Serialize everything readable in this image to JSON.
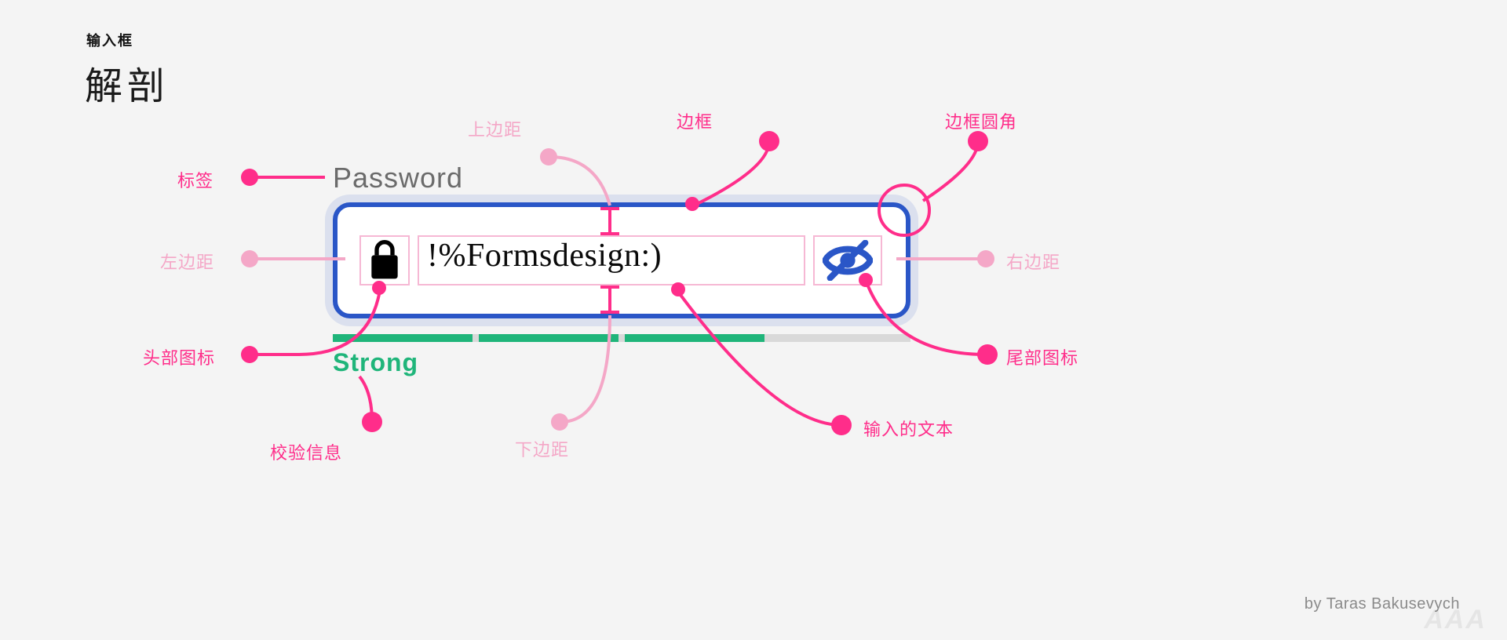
{
  "header": {
    "kicker": "输入框",
    "title": "解剖"
  },
  "field": {
    "label": "Password",
    "value": "!%Formsdesign:)",
    "strength_label": "Strong",
    "strength_segments_filled": 3,
    "strength_segments_total": 4
  },
  "icons": {
    "leading": "lock-icon",
    "trailing": "eye-off-icon"
  },
  "callouts": {
    "label": "标签",
    "left_padding": "左边距",
    "leading_icon": "头部图标",
    "validation": "校验信息",
    "top_padding": "上边距",
    "bottom_padding": "下边距",
    "border": "边框",
    "border_radius": "边框圆角",
    "right_padding": "右边距",
    "trailing_icon": "尾部图标",
    "input_text": "输入的文本"
  },
  "credit": "by Taras Bakusevych",
  "watermark": "AAA"
}
